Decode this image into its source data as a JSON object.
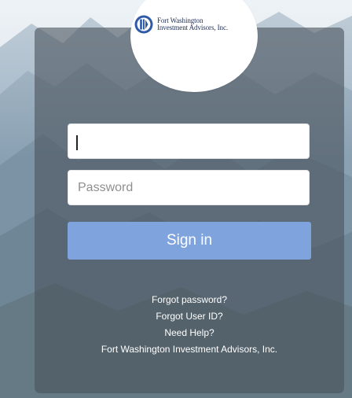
{
  "logo": {
    "line1": "Fort Washington",
    "line2": "Investment Advisors, Inc."
  },
  "login": {
    "username_value": "",
    "password_placeholder": "Password",
    "signin_label": "Sign in"
  },
  "links": {
    "forgot_password": "Forgot password?",
    "forgot_user_id": "Forgot User ID?",
    "need_help": "Need Help?",
    "company": "Fort Washington Investment Advisors, Inc."
  },
  "colors": {
    "signin_button": "#7fa3dd",
    "panel": "#4a545d",
    "logo_blue": "#2e5aa8",
    "logo_text": "#1f2d55"
  },
  "icons": {
    "logo_mark": "fort-washington-logo-icon"
  }
}
